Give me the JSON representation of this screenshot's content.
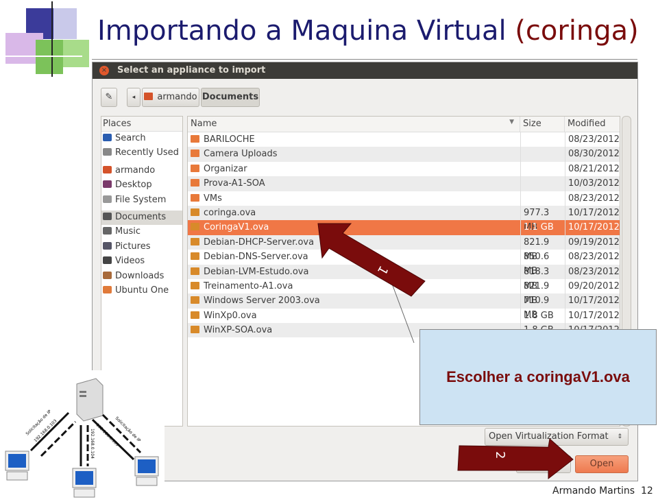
{
  "slide": {
    "title_main": "Importando a Maquina Virtual ",
    "title_highlight": "(coringa)",
    "footer_author": "Armando Martins",
    "page_number": "12"
  },
  "dialog": {
    "title": "Select an appliance to import",
    "breadcrumb": [
      "armando",
      "Documents"
    ],
    "places_header": "Places",
    "places": [
      {
        "label": "Search",
        "icon": "search-icon"
      },
      {
        "label": "Recently Used",
        "icon": "clock-icon"
      },
      {
        "label": "armando",
        "icon": "home-folder-icon"
      },
      {
        "label": "Desktop",
        "icon": "desktop-icon"
      },
      {
        "label": "File System",
        "icon": "drive-icon"
      },
      {
        "label": "Documents",
        "icon": "documents-icon",
        "selected": true
      },
      {
        "label": "Music",
        "icon": "music-icon"
      },
      {
        "label": "Pictures",
        "icon": "pictures-icon"
      },
      {
        "label": "Videos",
        "icon": "videos-icon"
      },
      {
        "label": "Downloads",
        "icon": "downloads-icon"
      },
      {
        "label": "Ubuntu One",
        "icon": "folder-icon"
      }
    ],
    "columns": {
      "name": "Name",
      "size": "Size",
      "modified": "Modified"
    },
    "files": [
      {
        "name": "BARILOCHE",
        "size": "",
        "modified": "08/23/2012",
        "type": "folder"
      },
      {
        "name": "Camera Uploads",
        "size": "",
        "modified": "08/30/2012",
        "type": "folder"
      },
      {
        "name": "Organizar",
        "size": "",
        "modified": "08/21/2012",
        "type": "folder"
      },
      {
        "name": "Prova-A1-SOA",
        "size": "",
        "modified": "10/03/2012",
        "type": "folder"
      },
      {
        "name": "VMs",
        "size": "",
        "modified": "08/23/2012",
        "type": "folder"
      },
      {
        "name": "coringa.ova",
        "size": "977.3 MB",
        "modified": "10/17/2012",
        "type": "package"
      },
      {
        "name": "CoringaV1.ova",
        "size": "1.1 GB",
        "modified": "10/17/2012",
        "type": "package",
        "selected": true
      },
      {
        "name": "Debian-DHCP-Server.ova",
        "size": "821.9 MB",
        "modified": "09/19/2012",
        "type": "package"
      },
      {
        "name": "Debian-DNS-Server.ova",
        "size": "850.6 MB",
        "modified": "08/23/2012",
        "type": "package"
      },
      {
        "name": "Debian-LVM-Estudo.ova",
        "size": "818.3 MB",
        "modified": "08/23/2012",
        "type": "package"
      },
      {
        "name": "Treinamento-A1.ova",
        "size": "821.9 MB",
        "modified": "09/20/2012",
        "type": "package"
      },
      {
        "name": "Windows Server 2003.ova",
        "size": "710.9 MB",
        "modified": "10/17/2012",
        "type": "package"
      },
      {
        "name": "WinXp0.ova",
        "size": "1.8 GB",
        "modified": "10/17/2012",
        "type": "package"
      },
      {
        "name": "WinXP-SOA.ova",
        "size": "1.8 GB",
        "modified": "10/17/2012",
        "type": "package"
      }
    ],
    "filter": "Open Virtualization Format",
    "open_label": "Open"
  },
  "annotations": {
    "arrow1_label": "1",
    "arrow2_label": "2",
    "callout": "Escolher a coringaV1.ova"
  },
  "network": {
    "request": "Solicitação de IP",
    "ips": [
      "192.168.0.103",
      "192.168.0.104",
      "192.168.0.105"
    ]
  },
  "colors": {
    "selection": "#f07746",
    "arrow": "#7a0c0c",
    "callout_bg": "#cde3f3",
    "title": "#1b1b6e"
  }
}
